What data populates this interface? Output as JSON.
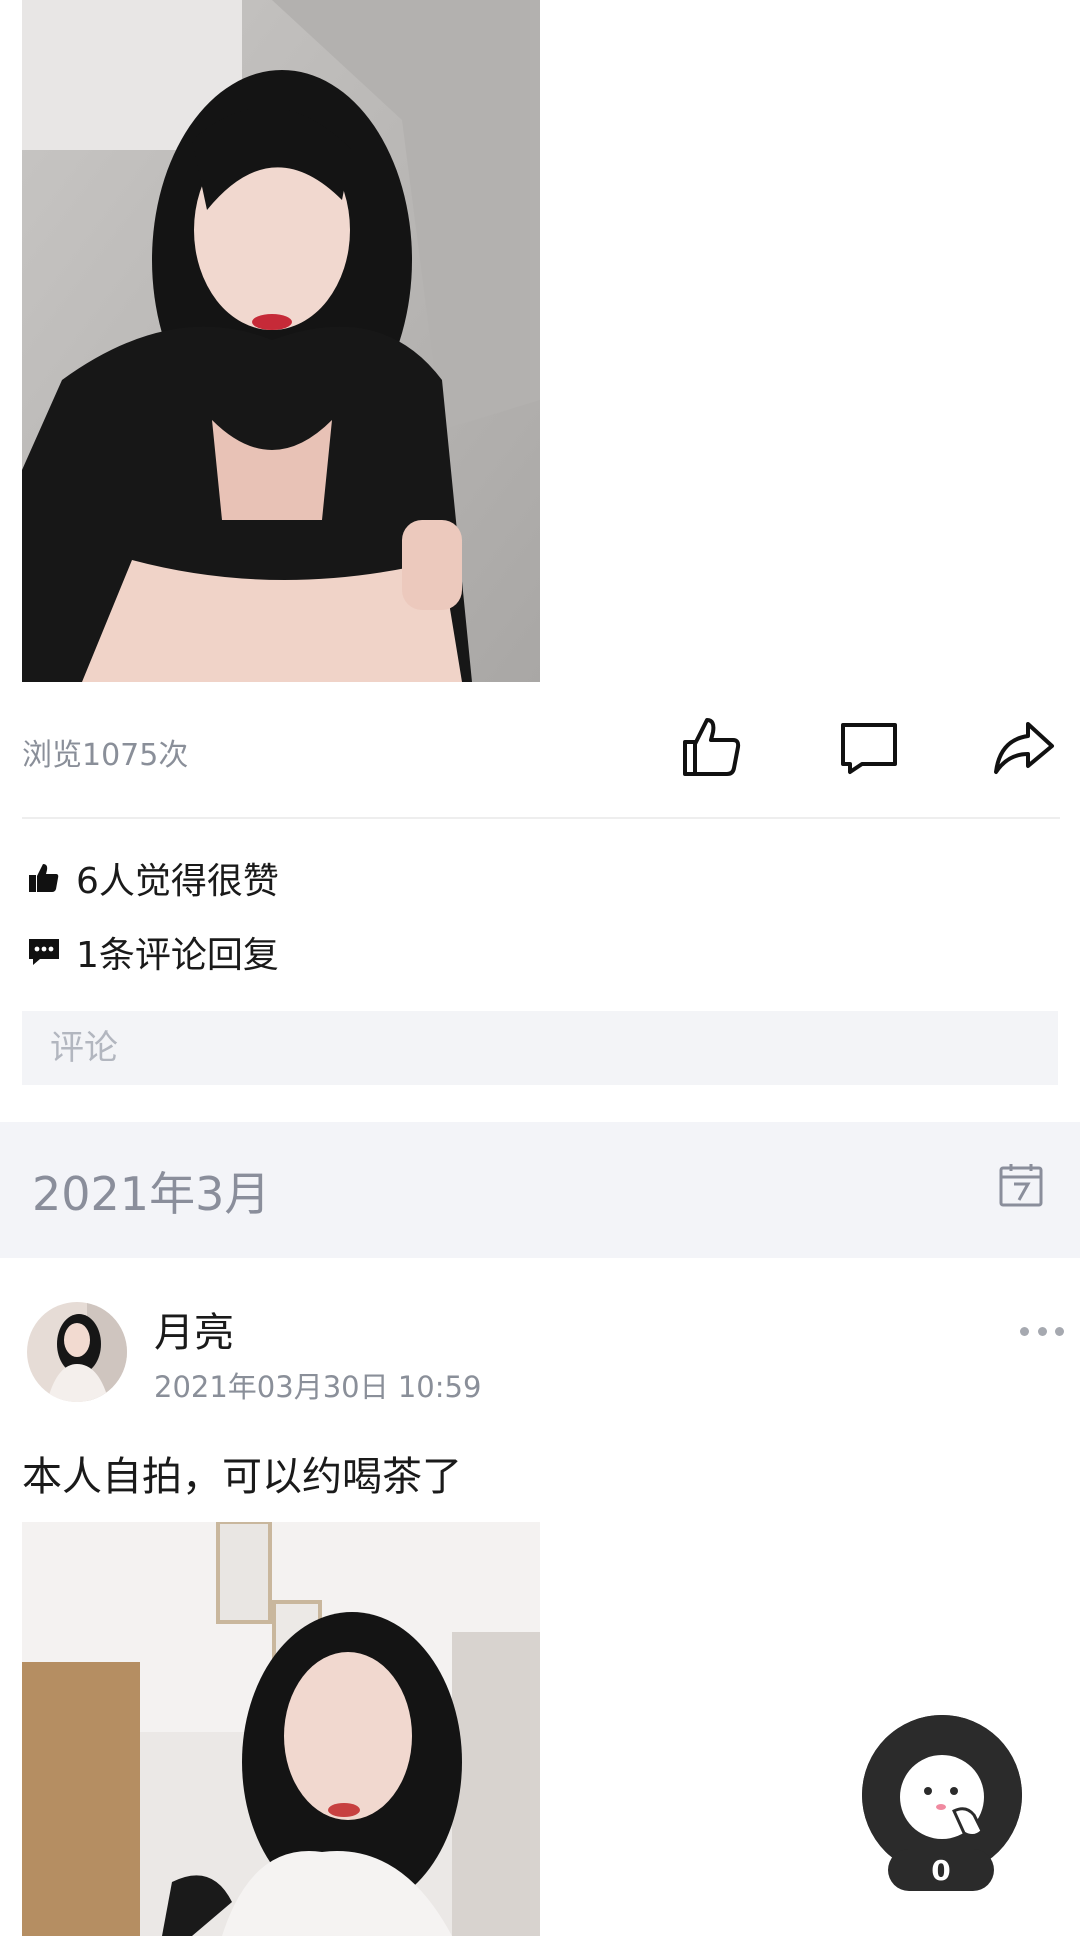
{
  "post_top": {
    "views_text": "浏览1075次",
    "likes_text": "6人觉得很赞",
    "comments_text": "1条评论回复",
    "comment_placeholder": "评论"
  },
  "month_bar": {
    "label": "2021年3月"
  },
  "post_second": {
    "username": "月亮",
    "timestamp": "2021年03月30日 10:59",
    "content": "本人自拍，可以约喝茶了"
  },
  "float_widget": {
    "count": "0"
  },
  "icons": {
    "like": "thumbs-up-icon",
    "comment": "comment-bubble-icon",
    "share": "share-arrow-icon",
    "calendar": "calendar-icon",
    "more": "more-dots-icon"
  },
  "colors": {
    "secondary_text": "#8a8f99",
    "month_bar_bg": "#f3f4f8",
    "input_bg": "#f3f4f7",
    "float_bg": "#2b2b2b"
  }
}
